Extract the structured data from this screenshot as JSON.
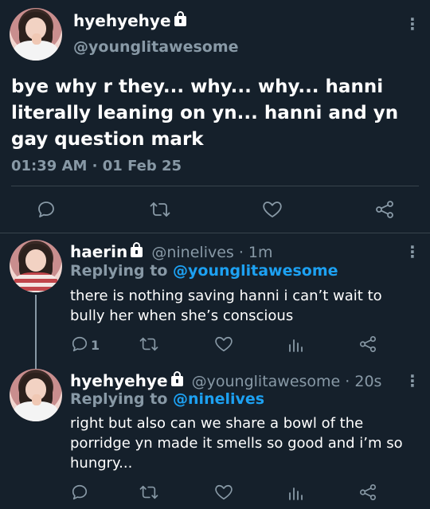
{
  "main_tweet": {
    "display_name": "hyehyehye",
    "handle": "@younglitawesome",
    "text": "bye why r they... why... why... hanni literally leaning on yn... hanni and yn gay question mark",
    "timestamp": "01:39 AM · 01 Feb 25",
    "actions": [
      "reply-icon",
      "retweet-icon",
      "like-icon",
      "share-icon"
    ]
  },
  "replies": [
    {
      "display_name": "haerin",
      "handle_time": "@ninelives · 1m",
      "replying_prefix": "Replying to",
      "replying_to": "@younglitawesome",
      "text": "there is nothing saving hanni i can’t wait to bully her when she’s conscious",
      "reply_count": "1"
    },
    {
      "display_name": "hyehyehye",
      "handle_time": "@younglitawesome · 20s",
      "replying_prefix": "Replying to",
      "replying_to": "@ninelives",
      "text": "right but also can we share a bowl of the porridge yn made it smells so good and i’m so hungry..."
    }
  ],
  "colors": {
    "background": "#15202b",
    "secondary_text": "#8899a6",
    "accent": "#1da1f2",
    "divider": "#38444d"
  }
}
